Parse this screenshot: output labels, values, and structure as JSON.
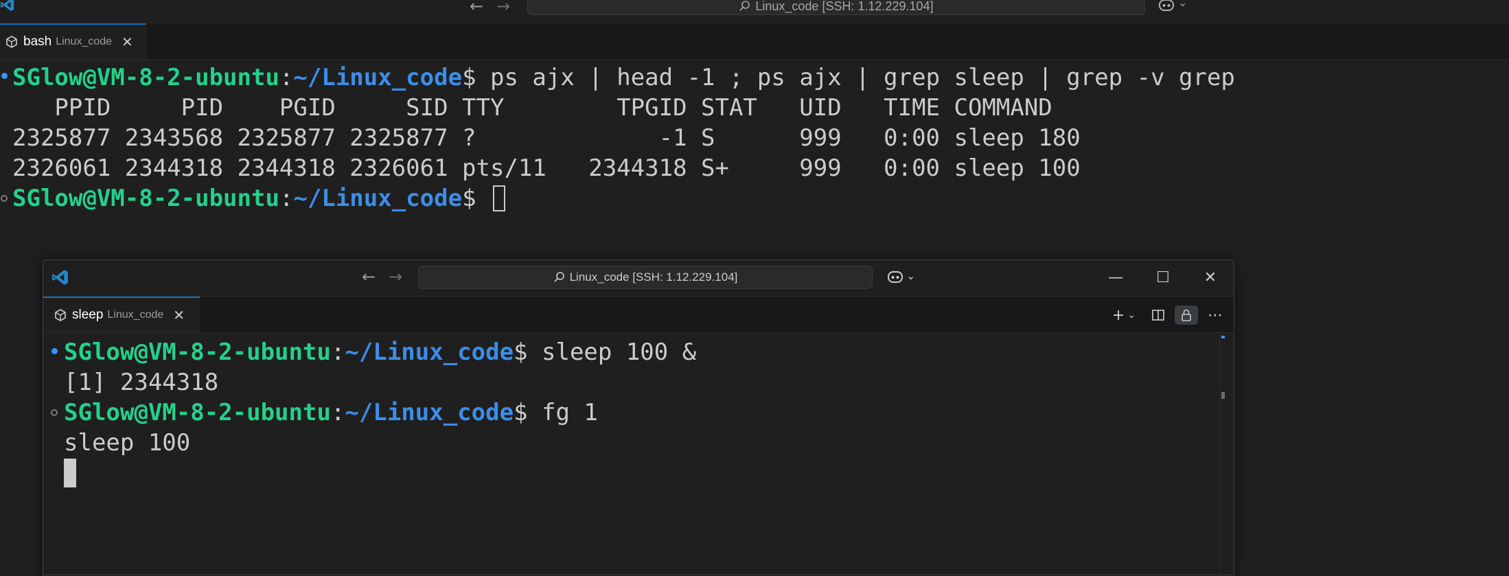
{
  "background_window": {
    "command_center": "Linux_code [SSH: 1.12.229.104]",
    "tab": {
      "name": "bash",
      "description": "Linux_code"
    },
    "terminal": {
      "line1": {
        "user": "SGlow@VM-8-2-ubuntu",
        "sep": ":",
        "path": "~/Linux_code",
        "cmd": "$ ps ajx | head -1 ; ps ajx | grep sleep | grep -v grep"
      },
      "header": "   PPID     PID    PGID     SID TTY        TPGID STAT   UID   TIME COMMAND",
      "rows": [
        "2325877 2343568 2325877 2325877 ?             -1 S      999   0:00 sleep 180",
        "2326061 2344318 2344318 2326061 pts/11   2344318 S+     999   0:00 sleep 100"
      ],
      "line_last": {
        "user": "SGlow@VM-8-2-ubuntu",
        "sep": ":",
        "path": "~/Linux_code",
        "cmd": "$ "
      }
    }
  },
  "foreground_window": {
    "command_center": "Linux_code [SSH: 1.12.229.104]",
    "tab": {
      "name": "sleep",
      "description": "Linux_code"
    },
    "terminal": {
      "line1": {
        "user": "SGlow@VM-8-2-ubuntu",
        "sep": ":",
        "path": "~/Linux_code",
        "cmd": "$ sleep 100 &"
      },
      "line2": "[1] 2344318",
      "line3": {
        "user": "SGlow@VM-8-2-ubuntu",
        "sep": ":",
        "path": "~/Linux_code",
        "cmd": "$ fg 1"
      },
      "line4": "sleep 100"
    }
  },
  "colors": {
    "accent": "#0078d4",
    "prompt_user": "#23d18b",
    "prompt_path": "#3b8eea",
    "terminal_fg": "#cccccc",
    "background": "#1f1f1f"
  },
  "icons": [
    "vscode-logo-icon",
    "arrow-left-icon",
    "arrow-right-icon",
    "search-icon",
    "copilot-icon",
    "chevron-down-icon",
    "terminal-tab-icon",
    "close-icon",
    "minimize-icon",
    "maximize-icon",
    "plus-icon",
    "split-terminal-icon",
    "lock-icon",
    "more-icon"
  ]
}
